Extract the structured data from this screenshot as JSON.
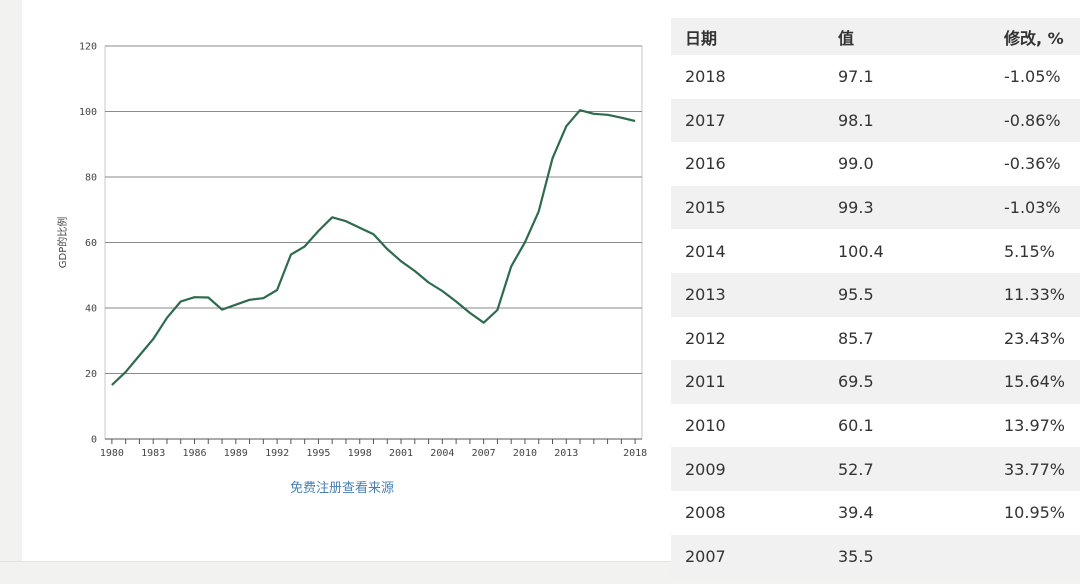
{
  "chart_data": {
    "type": "line",
    "ylabel": "GDP的比例",
    "xlabel": "",
    "ylim": [
      0,
      120
    ],
    "yticks": [
      0,
      20,
      40,
      60,
      80,
      100,
      120
    ],
    "xlim": [
      1979.5,
      2018.5
    ],
    "xtick_labels": [
      "1980",
      "1983",
      "1986",
      "1989",
      "1992",
      "1995",
      "1998",
      "2001",
      "2004",
      "2007",
      "2010",
      "2013",
      "2018"
    ],
    "grid": true,
    "series": [
      {
        "color": "#2e6b4e",
        "x": [
          1980,
          1981,
          1982,
          1983,
          1984,
          1985,
          1986,
          1987,
          1988,
          1989,
          1990,
          1991,
          1992,
          1993,
          1994,
          1995,
          1996,
          1997,
          1998,
          1999,
          2000,
          2001,
          2002,
          2003,
          2004,
          2005,
          2006,
          2007,
          2008,
          2009,
          2010,
          2011,
          2012,
          2013,
          2014,
          2015,
          2016,
          2017,
          2018
        ],
        "values": [
          16.5,
          20.5,
          25.5,
          30.5,
          37.0,
          42.0,
          43.3,
          43.2,
          39.5,
          41.0,
          42.5,
          43.0,
          45.5,
          56.3,
          58.8,
          63.5,
          67.7,
          66.5,
          64.5,
          62.5,
          58.0,
          54.3,
          51.3,
          47.8,
          45.2,
          42.0,
          38.5,
          35.5,
          39.4,
          52.7,
          60.1,
          69.5,
          85.7,
          95.5,
          100.4,
          99.3,
          99.0,
          98.1,
          97.1
        ]
      }
    ]
  },
  "register_link": "免费注册查看来源",
  "table": {
    "headers": {
      "date": "日期",
      "value": "值",
      "change": "修改, %"
    },
    "rows": [
      {
        "date": "2018",
        "value": "97.1",
        "change": "-1.05%"
      },
      {
        "date": "2017",
        "value": "98.1",
        "change": "-0.86%"
      },
      {
        "date": "2016",
        "value": "99.0",
        "change": "-0.36%"
      },
      {
        "date": "2015",
        "value": "99.3",
        "change": "-1.03%"
      },
      {
        "date": "2014",
        "value": "100.4",
        "change": "5.15%"
      },
      {
        "date": "2013",
        "value": "95.5",
        "change": "11.33%"
      },
      {
        "date": "2012",
        "value": "85.7",
        "change": "23.43%"
      },
      {
        "date": "2011",
        "value": "69.5",
        "change": "15.64%"
      },
      {
        "date": "2010",
        "value": "60.1",
        "change": "13.97%"
      },
      {
        "date": "2009",
        "value": "52.7",
        "change": "33.77%"
      },
      {
        "date": "2008",
        "value": "39.4",
        "change": "10.95%"
      },
      {
        "date": "2007",
        "value": "35.5",
        "change": ""
      }
    ]
  }
}
